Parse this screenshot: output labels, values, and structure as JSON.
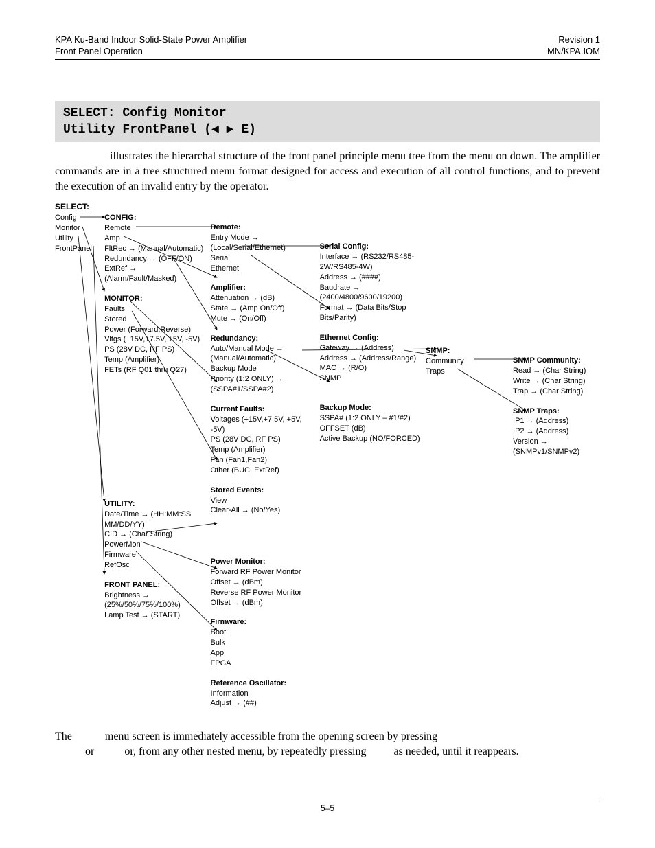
{
  "header": {
    "left1": "KPA Ku-Band Indoor Solid-State Power Amplifier",
    "left2": "Front Panel Operation",
    "right1": "Revision 1",
    "right2": "MN/KPA.IOM"
  },
  "lcd": {
    "line1": "SELECT: Config Monitor",
    "line2": "Utility FrontPanel (◀ ▶ E)"
  },
  "para1": "illustrates the hierarchal structure of the front panel principle menu tree from the menu on down. The amplifier commands are in a tree structured menu format designed for access and execution of all control functions, and to prevent the execution of an invalid entry by the operator.",
  "figure": {
    "title": "SELECT:",
    "col0": [
      "Config",
      "Monitor",
      "Utility",
      "FrontPanel"
    ],
    "config": {
      "title": "CONFIG:",
      "items": [
        "Remote",
        "Amp",
        "FltRec → (Manual/Automatic)",
        "Redundancy → (OFF/ON)",
        "ExtRef → (Alarm/Fault/Masked)"
      ]
    },
    "monitor": {
      "title": "MONITOR:",
      "items": [
        "Faults",
        "Stored",
        "Power (Forward,Reverse)",
        "Vltgs (+15V,+7.5V, +5V, -5V)",
        "PS (28V DC, RF PS)",
        "Temp (Amplifier)",
        "FETs (RF Q01 thru Q27)"
      ]
    },
    "utility": {
      "title": "UTILITY:",
      "items": [
        "Date/Time → (HH:MM:SS MM/DD/YY)",
        "CID → (Char String)",
        "PowerMon",
        "Firmware",
        "RefOsc"
      ]
    },
    "frontpanel": {
      "title": "FRONT PANEL:",
      "items": [
        "Brightness → (25%/50%/75%/100%)",
        "Lamp Test → (START)"
      ]
    },
    "remote": {
      "title": "Remote:",
      "items": [
        "Entry Mode → (Local/Serial/Ethernet)",
        "Serial",
        "Ethernet"
      ]
    },
    "amplifier": {
      "title": "Amplifier:",
      "items": [
        "Attenuation → (dB)",
        "State → (Amp On/Off)",
        "Mute → (On/Off)"
      ]
    },
    "redundancy2": {
      "title": "Redundancy:",
      "items": [
        "Auto/Manual Mode → (Manual/Automatic)",
        "Backup Mode",
        "Priority (1:2 ONLY) → (SSPA#1/SSPA#2)"
      ]
    },
    "currentfaults": {
      "title": "Current Faults:",
      "items": [
        "Voltages (+15V,+7.5V, +5V, -5V)",
        "PS (28V DC, RF PS)",
        "Temp (Amplifier)",
        "Fan (Fan1,Fan2)",
        "Other (BUC, ExtRef)"
      ]
    },
    "storedevents": {
      "title": "Stored Events:",
      "items": [
        "View",
        "Clear-All → (No/Yes)"
      ]
    },
    "powermonitor": {
      "title": "Power Monitor:",
      "items": [
        "Forward RF Power Monitor Offset → (dBm)",
        "Reverse RF Power Monitor Offset → (dBm)"
      ]
    },
    "firmware2": {
      "title": "Firmware:",
      "items": [
        "Boot",
        "Bulk",
        "App",
        "FPGA"
      ]
    },
    "refosc2": {
      "title": "Reference Oscillator:",
      "items": [
        "Information",
        "Adjust → (##)"
      ]
    },
    "serialconfig": {
      "title": "Serial Config:",
      "items": [
        "Interface → (RS232/RS485-2W/RS485-4W)",
        "Address → (####)",
        "Baudrate → (2400/4800/9600/19200)",
        "Format → (Data Bits/Stop Bits/Parity)"
      ]
    },
    "ethernetconfig": {
      "title": "Ethernet Config:",
      "items": [
        "Gateway → (Address)",
        "Address → (Address/Range)",
        "MAC → (R/O)",
        "SNMP"
      ]
    },
    "backupmode": {
      "title": "Backup Mode:",
      "items": [
        "SSPA# (1:2 ONLY – #1/#2)",
        "OFFSET (dB)",
        "Active Backup (NO/FORCED)"
      ]
    },
    "snmp": {
      "title": "SNMP:",
      "items": [
        "Community",
        "Traps"
      ]
    },
    "snmpcommunity": {
      "title": "SNMP Community:",
      "items": [
        "Read → (Char String)",
        "Write → (Char String)",
        "Trap → (Char String)"
      ]
    },
    "snmptraps": {
      "title": "SNMP Traps:",
      "items": [
        "IP1 → (Address)",
        "IP2 → (Address)",
        "Version → (SNMPv1/SNMPv2)"
      ]
    }
  },
  "para2a": "The",
  "para2b": "menu screen is immediately accessible from the opening screen by pressing",
  "para2c": "or",
  "para2d": "or, from any other nested menu, by repeatedly pressing",
  "para2e": "as needed, until it reappears.",
  "footer": "5–5"
}
